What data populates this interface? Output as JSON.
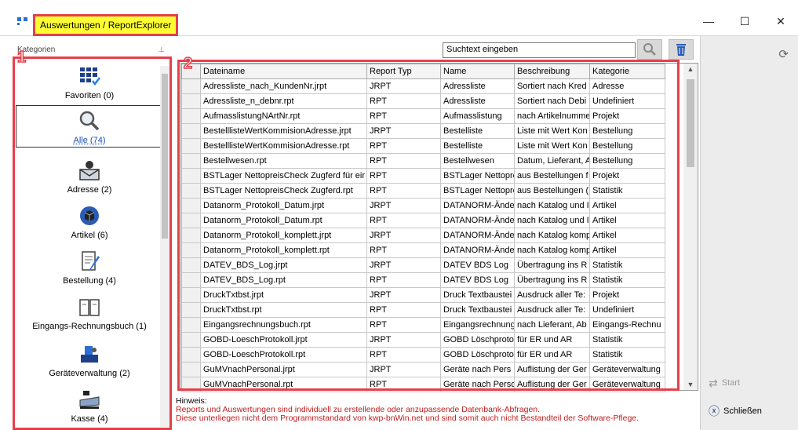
{
  "window": {
    "title": "Auswertungen / ReportExplorer",
    "controls": {
      "minimize": "—",
      "maximize": "☐",
      "close": "✕"
    }
  },
  "badges": {
    "left": "1",
    "grid": "2"
  },
  "categories": {
    "header": "Kategorien",
    "items": [
      {
        "label": "Favoriten (0)",
        "icon": "favorites-grid-icon",
        "selected": false
      },
      {
        "label": "Alle (74)",
        "icon": "magnifier-icon",
        "selected": true
      },
      {
        "label": "Adresse (2)",
        "icon": "mail-person-icon",
        "selected": false
      },
      {
        "label": "Artikel (6)",
        "icon": "box-sphere-icon",
        "selected": false
      },
      {
        "label": "Bestellung (4)",
        "icon": "notepad-pen-icon",
        "selected": false
      },
      {
        "label": "Eingangs-Rechnungsbuch (1)",
        "icon": "book-icon",
        "selected": false
      },
      {
        "label": "Geräteverwaltung (2)",
        "icon": "device-icon",
        "selected": false
      },
      {
        "label": "Kasse (4)",
        "icon": "cash-register-icon",
        "selected": false
      }
    ]
  },
  "search": {
    "placeholder": "Suchtext eingeben"
  },
  "grid": {
    "columns": [
      "Dateiname",
      "Report Typ",
      "Name",
      "Beschreibung",
      "Kategorie"
    ],
    "rows": [
      [
        "Adressliste_nach_KundenNr.jrpt",
        "JRPT",
        "Adressliste",
        "Sortiert nach Kred",
        "Adresse"
      ],
      [
        "Adressliste_n_debnr.rpt",
        "RPT",
        "Adressliste",
        "Sortiert nach Debi",
        "Undefiniert"
      ],
      [
        "AufmasslistungNArtNr.rpt",
        "RPT",
        "Aufmasslistung",
        "nach Artikelnumme",
        "Projekt"
      ],
      [
        "BestelllisteWertKommisionAdresse.jrpt",
        "JRPT",
        "Bestelliste",
        "Liste mit Wert Kon",
        "Bestellung"
      ],
      [
        "BestelllisteWertKommisionAdresse.rpt",
        "RPT",
        "Bestelliste",
        "Liste mit Wert Kon",
        "Bestellung"
      ],
      [
        "Bestellwesen.rpt",
        "RPT",
        "Bestellwesen",
        "Datum, Lieferant, A",
        "Bestellung"
      ],
      [
        "BSTLager NettopreisCheck Zugferd für eir",
        "RPT",
        "BSTLager Nettopre",
        "aus Bestellungen f",
        "Projekt"
      ],
      [
        "BSTLager NettopreisCheck Zugferd.rpt",
        "RPT",
        "BSTLager Nettopre",
        "aus Bestellungen (",
        "Statistik"
      ],
      [
        "Datanorm_Protokoll_Datum.jrpt",
        "JRPT",
        "DATANORM-Ände",
        "nach Katalog und I",
        "Artikel"
      ],
      [
        "Datanorm_Protokoll_Datum.rpt",
        "RPT",
        "DATANORM-Ände",
        "nach Katalog und I",
        "Artikel"
      ],
      [
        "Datanorm_Protokoll_komplett.jrpt",
        "JRPT",
        "DATANORM-Ände",
        "nach Katalog komp",
        "Artikel"
      ],
      [
        "Datanorm_Protokoll_komplett.rpt",
        "RPT",
        "DATANORM-Ände",
        "nach Katalog komp",
        "Artikel"
      ],
      [
        "DATEV_BDS_Log.jrpt",
        "JRPT",
        "DATEV BDS Log",
        "Übertragung ins R",
        "Statistik"
      ],
      [
        "DATEV_BDS_Log.rpt",
        "RPT",
        "DATEV BDS Log",
        "Übertragung ins R",
        "Statistik"
      ],
      [
        "DruckTxtbst.jrpt",
        "JRPT",
        "Druck Textbaustei",
        "Ausdruck aller Te:",
        "Projekt"
      ],
      [
        "DruckTxtbst.rpt",
        "RPT",
        "Druck Textbaustei",
        "Ausdruck aller Te:",
        "Undefiniert"
      ],
      [
        "Eingangsrechnungsbuch.rpt",
        "RPT",
        "Eingangsrechnung",
        "nach Lieferant, Ab",
        "Eingangs-Rechnu"
      ],
      [
        "GOBD-LoeschProtokoll.jrpt",
        "JRPT",
        "GOBD Löschproto",
        "für ER und AR",
        "Statistik"
      ],
      [
        "GOBD-LoeschProtokoll.rpt",
        "RPT",
        "GOBD Löschproto",
        "für ER und AR",
        "Statistik"
      ],
      [
        "GuMVnachPersonal.jrpt",
        "JRPT",
        "Geräte nach Pers",
        "Auflistung der Ger",
        "Geräteverwaltung"
      ],
      [
        "GuMVnachPersonal.rpt",
        "RPT",
        "Geräte nach Perso",
        "Auflistung der Ger",
        "Geräteverwaltung"
      ]
    ]
  },
  "actions": {
    "start": "Start",
    "close": "Schließen"
  },
  "hint": {
    "label": "Hinweis:",
    "line1": "Reports und Auswertungen sind individuell zu erstellende oder anzupassende Datenbank-Abfragen.",
    "line2": "Diese unterliegen nicht dem Programmstandard von kwp-bnWin.net und sind somit auch nicht Bestandteil der Software-Pflege."
  },
  "colors": {
    "highlight": "#ffff33",
    "frame": "#e5404a",
    "hint_text": "#c21b1b"
  }
}
